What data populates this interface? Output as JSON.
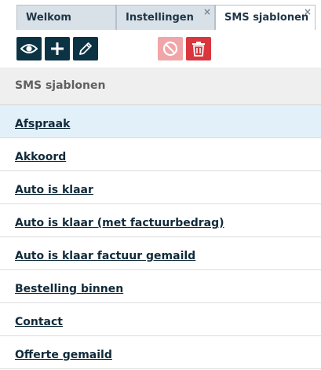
{
  "tabs": [
    {
      "label": "Welkom",
      "closable": false,
      "active": false
    },
    {
      "label": "Instellingen",
      "closable": true,
      "active": false
    },
    {
      "label": "SMS sjablonen",
      "closable": true,
      "active": true
    }
  ],
  "tab_close_glyph": "×",
  "toolbar": {
    "buttons": [
      {
        "icon": "eye-icon",
        "color": "#0b3344"
      },
      {
        "icon": "plus-icon",
        "color": "#0b3344"
      },
      {
        "icon": "pencil-icon",
        "color": "#0b3344"
      },
      {
        "icon": "ban-icon",
        "color": "#f0a6a8"
      },
      {
        "icon": "trash-icon",
        "color": "#d9363d"
      }
    ]
  },
  "list": {
    "header": "SMS sjablonen",
    "items": [
      "Afspraak",
      "Akkoord",
      "Auto is klaar",
      "Auto is klaar (met factuurbedrag)",
      "Auto is klaar factuur gemaild",
      "Bestelling binnen",
      "Contact",
      "Offerte gemaild"
    ],
    "selected_index": 0
  },
  "colors": {
    "selected_row": "#e2f0f9",
    "tab_inactive": "#d8e0e8",
    "dark_button": "#0b3344"
  }
}
